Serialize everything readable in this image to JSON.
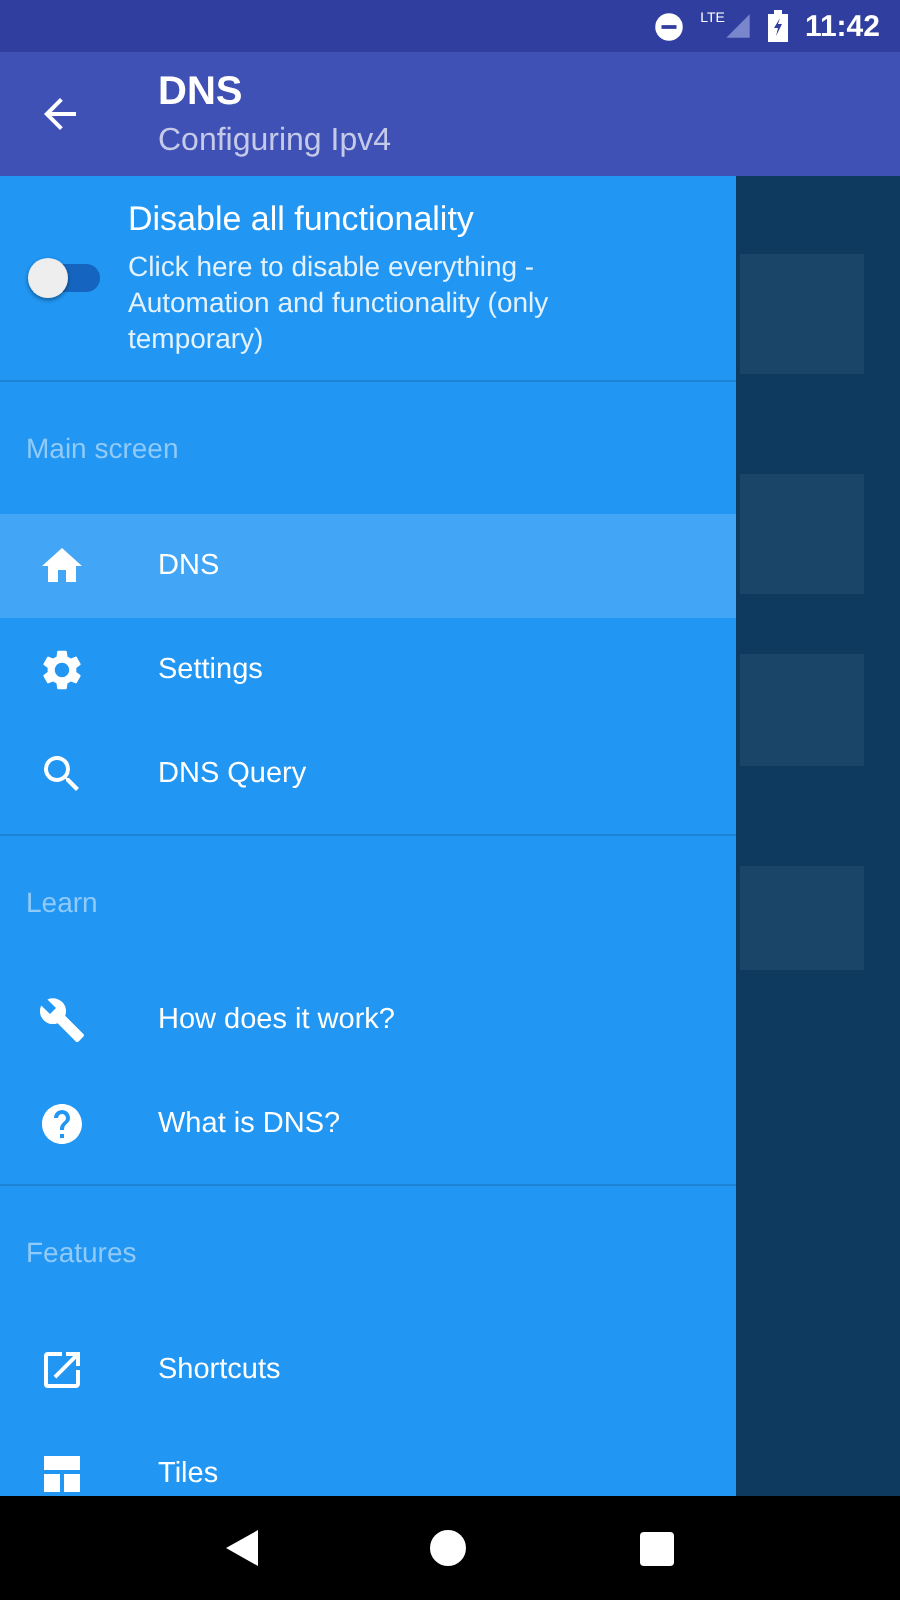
{
  "status_bar": {
    "network": "LTE",
    "time": "11:42"
  },
  "app_bar": {
    "title": "DNS",
    "subtitle": "Configuring Ipv4"
  },
  "drawer": {
    "toggle": {
      "title": "Disable all functionality",
      "description": "Click here to disable everything - Automation and functionality (only temporary)",
      "on": false
    },
    "sections": [
      {
        "header": "Main screen",
        "items": [
          {
            "label": "DNS",
            "kind": "home",
            "selected": true
          },
          {
            "label": "Settings",
            "kind": "settings",
            "selected": false
          },
          {
            "label": "DNS Query",
            "kind": "search",
            "selected": false
          }
        ]
      },
      {
        "header": "Learn",
        "items": [
          {
            "label": "How does it work?",
            "kind": "wrench",
            "selected": false
          },
          {
            "label": "What is DNS?",
            "kind": "help",
            "selected": false
          }
        ]
      },
      {
        "header": "Features",
        "items": [
          {
            "label": "Shortcuts",
            "kind": "open",
            "selected": false
          },
          {
            "label": "Tiles",
            "kind": "tiles",
            "selected": false
          }
        ]
      }
    ]
  }
}
